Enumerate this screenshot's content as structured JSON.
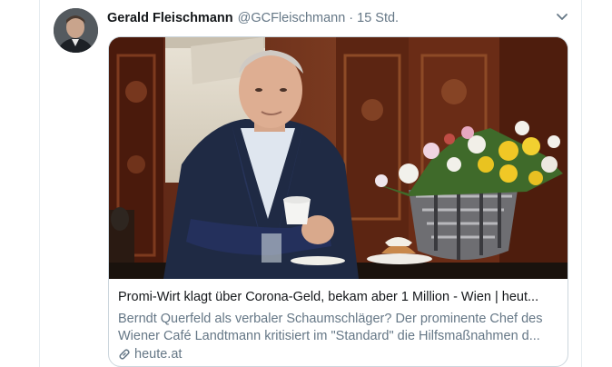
{
  "tweet": {
    "author_name": "Gerald Fleischmann",
    "author_handle": "@GCFleischmann",
    "separator": "·",
    "time": "15 Std."
  },
  "card": {
    "title": "Promi-Wirt klagt über Corona-Geld, bekam aber 1 Million - Wien | heut...",
    "description": "Berndt Querfeld als verbaler Schaumschläger? Der prominente Chef des Wiener Café Landtmann kritisiert im \"Standard\" die Hilfsmaßnahmen d...",
    "domain": "heute.at"
  },
  "icons": {
    "menu": "chevron-down-icon",
    "link": "link-icon"
  },
  "colors": {
    "name": "#14171a",
    "secondary": "#657786",
    "accent": "#1da1f2",
    "border": "#ccd6dd"
  }
}
